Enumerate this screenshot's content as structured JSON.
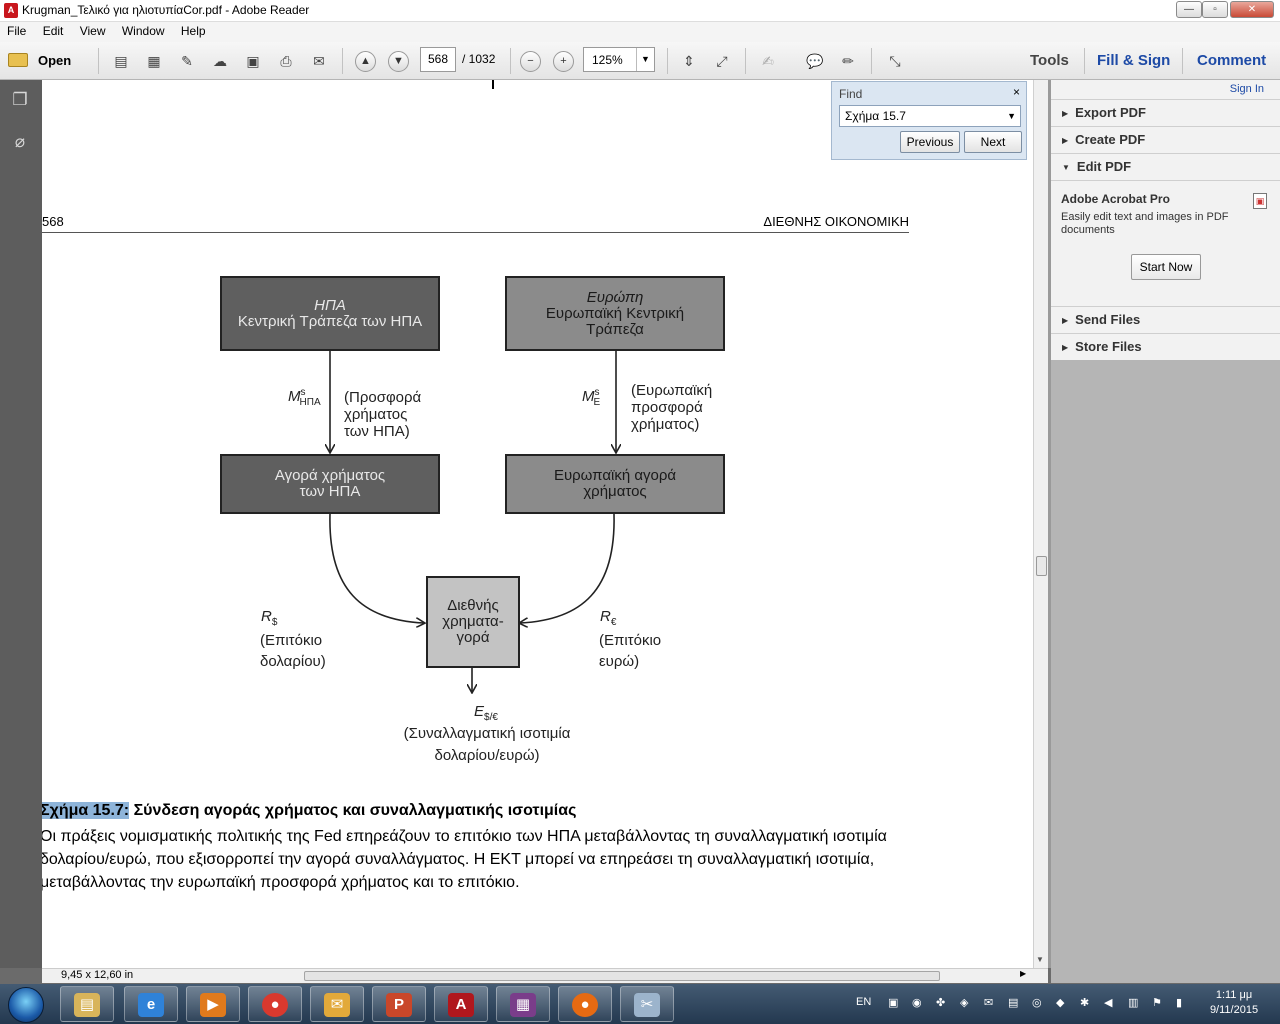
{
  "window": {
    "title": "Krugman_Τελικό για ηλιοτυπίαCor.pdf - Adobe Reader",
    "min_glyph": "—",
    "max_glyph": "▫",
    "close_glyph": "✕"
  },
  "menu": [
    "File",
    "Edit",
    "View",
    "Window",
    "Help"
  ],
  "toolbar": {
    "open_label": "Open",
    "page_current": "568",
    "page_total": "/ 1032",
    "zoom": "125%",
    "tools_label": "Tools",
    "fill_sign_label": "Fill & Sign",
    "comment_label": "Comment"
  },
  "find": {
    "label": "Find",
    "query": "Σχήμα 15.7",
    "close": "×",
    "previous": "Previous",
    "next": "Next"
  },
  "page": {
    "number": "568",
    "header": "ΔΙΕΘΝΗΣ ΟΙΚΟΝΟΜΙΚΗ"
  },
  "diagram": {
    "usa_cb": {
      "title": "ΗΠΑ",
      "subtitle": "Κεντρική Τράπεζα των ΗΠΑ"
    },
    "eu_cb": {
      "title": "Ευρώπη",
      "subtitle1": "Ευρωπαϊκή Κεντρική",
      "subtitle2": "Τράπεζα"
    },
    "usa_market": {
      "line1": "Αγορά χρήματος",
      "line2": "των ΗΠΑ"
    },
    "eu_market": {
      "line1": "Ευρωπαϊκή αγορά",
      "line2": "χρήματος"
    },
    "intl_market": {
      "line1": "Διεθνής",
      "line2": "χρηματα-",
      "line3": "γορά"
    },
    "usa_supply_sym": "M",
    "usa_supply_sup": "s",
    "usa_supply_sub": "ΗΠΑ",
    "usa_supply_desc": [
      "(Προσφορά",
      "χρήματος",
      "των ΗΠΑ)"
    ],
    "eu_supply_sym": "M",
    "eu_supply_sup": "s",
    "eu_supply_sub": "E",
    "eu_supply_desc": [
      "(Ευρωπαϊκή",
      "προσφορά",
      "χρήματος)"
    ],
    "r_usd_sym": "R",
    "r_usd_sub": "$",
    "r_usd_desc": [
      "(Επιτόκιο",
      "δολαρίου)"
    ],
    "r_eur_sym": "R",
    "r_eur_sub": "€",
    "r_eur_desc": [
      "(Επιτόκιο",
      "ευρώ)"
    ],
    "e_sym": "E",
    "e_sub": "$/€",
    "e_desc": [
      "(Συναλλαγματική ισοτιμία",
      "δολαρίου/ευρώ)"
    ]
  },
  "caption": {
    "label": "Σχήμα 15.7:",
    "title": " Σύνδεση αγοράς χρήματος και συναλλαγματικής ισοτιμίας",
    "body": "Οι πράξεις νομισματικής πολιτικής της Fed επηρεάζουν το επιτόκιο των ΗΠΑ μεταβάλλοντας τη συναλλαγματική ισοτιμία δολαρίου/ευρώ, που εξισορροπεί την αγορά συναλλάγματος. Η ΕΚΤ μπορεί να επηρεάσει τη συναλλαγματική ισοτιμία, μεταβάλλοντας την ευρωπαϊκή προσφορά χρήματος και το επιτόκιο."
  },
  "status": {
    "page_size": "9,45 x 12,60 in"
  },
  "right_panel": {
    "sign_in": "Sign In",
    "export_pdf": "Export PDF",
    "create_pdf": "Create PDF",
    "edit_pdf": "Edit PDF",
    "acro_title": "Adobe Acrobat Pro",
    "acro_desc": "Easily edit text and images in PDF documents",
    "start_now": "Start Now",
    "send_files": "Send Files",
    "store_files": "Store Files"
  },
  "taskbar": {
    "lang": "EN",
    "time": "1:11 μμ",
    "date": "9/11/2015"
  },
  "colors": {
    "accent_blue": "#1d4aa6",
    "find_panel": "#dbe6f2",
    "caption_highlight": "#8eb4d9"
  }
}
